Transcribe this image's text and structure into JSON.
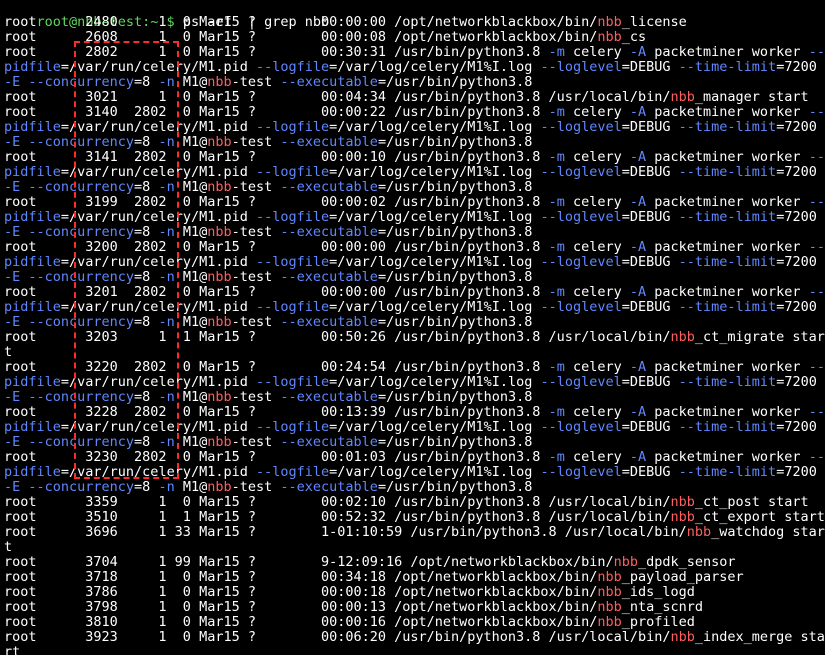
{
  "terminal": {
    "prompt": "root@nbb-test:~ $",
    "command": "ps -ef  | grep nbb",
    "lines": [
      [
        [
          "t",
          "root      2480     1  0 Mar15 ?        00:00:00 /opt/networkblackbox/bin/"
        ],
        [
          "h",
          "nbb"
        ],
        [
          "t",
          "_license"
        ]
      ],
      [
        [
          "t",
          "root      2608     1  0 Mar15 ?        00:00:08 /opt/networkblackbox/bin/"
        ],
        [
          "h",
          "nbb"
        ],
        [
          "t",
          "_cs"
        ]
      ],
      [
        [
          "t",
          "root      2802     1  0 Mar15 ?        00:30:31 /usr/bin/python3.8 "
        ],
        [
          "o",
          "-m"
        ],
        [
          "t",
          " celery "
        ],
        [
          "o",
          "-A"
        ],
        [
          "t",
          " packetminer worker "
        ],
        [
          "o",
          "--"
        ]
      ],
      [
        [
          "o",
          "pidfile"
        ],
        [
          "t",
          "=/var/run/celery/M1.pid "
        ],
        [
          "o",
          "--logfile"
        ],
        [
          "t",
          "=/var/log/celery/M1%I.log "
        ],
        [
          "o",
          "--loglevel"
        ],
        [
          "t",
          "=DEBUG "
        ],
        [
          "o",
          "--time-limit"
        ],
        [
          "t",
          "=7200"
        ]
      ],
      [
        [
          "o",
          "-E --concurrency"
        ],
        [
          "t",
          "=8 "
        ],
        [
          "o",
          "-n"
        ],
        [
          "t",
          " M1@"
        ],
        [
          "h",
          "nbb"
        ],
        [
          "t",
          "-test "
        ],
        [
          "o",
          "--executable"
        ],
        [
          "t",
          "=/usr/bin/python3.8"
        ]
      ],
      [
        [
          "t",
          "root      3021     1  0 Mar15 ?        00:04:34 /usr/bin/python3.8 /usr/local/bin/"
        ],
        [
          "h",
          "nbb"
        ],
        [
          "t",
          "_manager start"
        ]
      ],
      [
        [
          "t",
          "root      3140  2802  0 Mar15 ?        00:00:22 /usr/bin/python3.8 "
        ],
        [
          "o",
          "-m"
        ],
        [
          "t",
          " celery "
        ],
        [
          "o",
          "-A"
        ],
        [
          "t",
          " packetminer worker "
        ],
        [
          "o",
          "--"
        ]
      ],
      [
        [
          "o",
          "pidfile"
        ],
        [
          "t",
          "=/var/run/celery/M1.pid "
        ],
        [
          "o",
          "--logfile"
        ],
        [
          "t",
          "=/var/log/celery/M1%I.log "
        ],
        [
          "o",
          "--loglevel"
        ],
        [
          "t",
          "=DEBUG "
        ],
        [
          "o",
          "--time-limit"
        ],
        [
          "t",
          "=7200"
        ]
      ],
      [
        [
          "o",
          "-E --concurrency"
        ],
        [
          "t",
          "=8 "
        ],
        [
          "o",
          "-n"
        ],
        [
          "t",
          " M1@"
        ],
        [
          "h",
          "nbb"
        ],
        [
          "t",
          "-test "
        ],
        [
          "o",
          "--executable"
        ],
        [
          "t",
          "=/usr/bin/python3.8"
        ]
      ],
      [
        [
          "t",
          "root      3141  2802  0 Mar15 ?        00:00:10 /usr/bin/python3.8 "
        ],
        [
          "o",
          "-m"
        ],
        [
          "t",
          " celery "
        ],
        [
          "o",
          "-A"
        ],
        [
          "t",
          " packetminer worker "
        ],
        [
          "o",
          "--"
        ]
      ],
      [
        [
          "o",
          "pidfile"
        ],
        [
          "t",
          "=/var/run/celery/M1.pid "
        ],
        [
          "o",
          "--logfile"
        ],
        [
          "t",
          "=/var/log/celery/M1%I.log "
        ],
        [
          "o",
          "--loglevel"
        ],
        [
          "t",
          "=DEBUG "
        ],
        [
          "o",
          "--time-limit"
        ],
        [
          "t",
          "=7200"
        ]
      ],
      [
        [
          "o",
          "-E --concurrency"
        ],
        [
          "t",
          "=8 "
        ],
        [
          "o",
          "-n"
        ],
        [
          "t",
          " M1@"
        ],
        [
          "h",
          "nbb"
        ],
        [
          "t",
          "-test "
        ],
        [
          "o",
          "--executable"
        ],
        [
          "t",
          "=/usr/bin/python3.8"
        ]
      ],
      [
        [
          "t",
          "root      3199  2802  0 Mar15 ?        00:00:02 /usr/bin/python3.8 "
        ],
        [
          "o",
          "-m"
        ],
        [
          "t",
          " celery "
        ],
        [
          "o",
          "-A"
        ],
        [
          "t",
          " packetminer worker "
        ],
        [
          "o",
          "--"
        ]
      ],
      [
        [
          "o",
          "pidfile"
        ],
        [
          "t",
          "=/var/run/celery/M1.pid "
        ],
        [
          "o",
          "--logfile"
        ],
        [
          "t",
          "=/var/log/celery/M1%I.log "
        ],
        [
          "o",
          "--loglevel"
        ],
        [
          "t",
          "=DEBUG "
        ],
        [
          "o",
          "--time-limit"
        ],
        [
          "t",
          "=7200"
        ]
      ],
      [
        [
          "o",
          "-E --concurrency"
        ],
        [
          "t",
          "=8 "
        ],
        [
          "o",
          "-n"
        ],
        [
          "t",
          " M1@"
        ],
        [
          "h",
          "nbb"
        ],
        [
          "t",
          "-test "
        ],
        [
          "o",
          "--executable"
        ],
        [
          "t",
          "=/usr/bin/python3.8"
        ]
      ],
      [
        [
          "t",
          "root      3200  2802  0 Mar15 ?        00:00:00 /usr/bin/python3.8 "
        ],
        [
          "o",
          "-m"
        ],
        [
          "t",
          " celery "
        ],
        [
          "o",
          "-A"
        ],
        [
          "t",
          " packetminer worker "
        ],
        [
          "o",
          "--"
        ]
      ],
      [
        [
          "o",
          "pidfile"
        ],
        [
          "t",
          "=/var/run/celery/M1.pid "
        ],
        [
          "o",
          "--logfile"
        ],
        [
          "t",
          "=/var/log/celery/M1%I.log "
        ],
        [
          "o",
          "--loglevel"
        ],
        [
          "t",
          "=DEBUG "
        ],
        [
          "o",
          "--time-limit"
        ],
        [
          "t",
          "=7200"
        ]
      ],
      [
        [
          "o",
          "-E --concurrency"
        ],
        [
          "t",
          "=8 "
        ],
        [
          "o",
          "-n"
        ],
        [
          "t",
          " M1@"
        ],
        [
          "h",
          "nbb"
        ],
        [
          "t",
          "-test "
        ],
        [
          "o",
          "--executable"
        ],
        [
          "t",
          "=/usr/bin/python3.8"
        ]
      ],
      [
        [
          "t",
          "root      3201  2802  0 Mar15 ?        00:00:00 /usr/bin/python3.8 "
        ],
        [
          "o",
          "-m"
        ],
        [
          "t",
          " celery "
        ],
        [
          "o",
          "-A"
        ],
        [
          "t",
          " packetminer worker "
        ],
        [
          "o",
          "--"
        ]
      ],
      [
        [
          "o",
          "pidfile"
        ],
        [
          "t",
          "=/var/run/celery/M1.pid "
        ],
        [
          "o",
          "--logfile"
        ],
        [
          "t",
          "=/var/log/celery/M1%I.log "
        ],
        [
          "o",
          "--loglevel"
        ],
        [
          "t",
          "=DEBUG "
        ],
        [
          "o",
          "--time-limit"
        ],
        [
          "t",
          "=7200"
        ]
      ],
      [
        [
          "o",
          "-E --concurrency"
        ],
        [
          "t",
          "=8 "
        ],
        [
          "o",
          "-n"
        ],
        [
          "t",
          " M1@"
        ],
        [
          "h",
          "nbb"
        ],
        [
          "t",
          "-test "
        ],
        [
          "o",
          "--executable"
        ],
        [
          "t",
          "=/usr/bin/python3.8"
        ]
      ],
      [
        [
          "t",
          "root      3203     1  1 Mar15 ?        00:50:26 /usr/bin/python3.8 /usr/local/bin/"
        ],
        [
          "h",
          "nbb"
        ],
        [
          "t",
          "_ct_migrate star"
        ]
      ],
      [
        [
          "t",
          "t"
        ]
      ],
      [
        [
          "t",
          "root      3220  2802  0 Mar15 ?        00:24:54 /usr/bin/python3.8 "
        ],
        [
          "o",
          "-m"
        ],
        [
          "t",
          " celery "
        ],
        [
          "o",
          "-A"
        ],
        [
          "t",
          " packetminer worker "
        ],
        [
          "o",
          "--"
        ]
      ],
      [
        [
          "o",
          "pidfile"
        ],
        [
          "t",
          "=/var/run/celery/M1.pid "
        ],
        [
          "o",
          "--logfile"
        ],
        [
          "t",
          "=/var/log/celery/M1%I.log "
        ],
        [
          "o",
          "--loglevel"
        ],
        [
          "t",
          "=DEBUG "
        ],
        [
          "o",
          "--time-limit"
        ],
        [
          "t",
          "=7200"
        ]
      ],
      [
        [
          "o",
          "-E --concurrency"
        ],
        [
          "t",
          "=8 "
        ],
        [
          "o",
          "-n"
        ],
        [
          "t",
          " M1@"
        ],
        [
          "h",
          "nbb"
        ],
        [
          "t",
          "-test "
        ],
        [
          "o",
          "--executable"
        ],
        [
          "t",
          "=/usr/bin/python3.8"
        ]
      ],
      [
        [
          "t",
          "root      3228  2802  0 Mar15 ?        00:13:39 /usr/bin/python3.8 "
        ],
        [
          "o",
          "-m"
        ],
        [
          "t",
          " celery "
        ],
        [
          "o",
          "-A"
        ],
        [
          "t",
          " packetminer worker "
        ],
        [
          "o",
          "--"
        ]
      ],
      [
        [
          "o",
          "pidfile"
        ],
        [
          "t",
          "=/var/run/celery/M1.pid "
        ],
        [
          "o",
          "--logfile"
        ],
        [
          "t",
          "=/var/log/celery/M1%I.log "
        ],
        [
          "o",
          "--loglevel"
        ],
        [
          "t",
          "=DEBUG "
        ],
        [
          "o",
          "--time-limit"
        ],
        [
          "t",
          "=7200"
        ]
      ],
      [
        [
          "o",
          "-E --concurrency"
        ],
        [
          "t",
          "=8 "
        ],
        [
          "o",
          "-n"
        ],
        [
          "t",
          " M1@"
        ],
        [
          "h",
          "nbb"
        ],
        [
          "t",
          "-test "
        ],
        [
          "o",
          "--executable"
        ],
        [
          "t",
          "=/usr/bin/python3.8"
        ]
      ],
      [
        [
          "t",
          "root      3230  2802  0 Mar15 ?        00:01:03 /usr/bin/python3.8 "
        ],
        [
          "o",
          "-m"
        ],
        [
          "t",
          " celery "
        ],
        [
          "o",
          "-A"
        ],
        [
          "t",
          " packetminer worker "
        ],
        [
          "o",
          "--"
        ]
      ],
      [
        [
          "o",
          "pidfile"
        ],
        [
          "t",
          "=/var/run/celery/M1.pid "
        ],
        [
          "o",
          "--logfile"
        ],
        [
          "t",
          "=/var/log/celery/M1%I.log "
        ],
        [
          "o",
          "--loglevel"
        ],
        [
          "t",
          "=DEBUG "
        ],
        [
          "o",
          "--time-limit"
        ],
        [
          "t",
          "=7200"
        ]
      ],
      [
        [
          "o",
          "-E --concurrency"
        ],
        [
          "t",
          "=8 "
        ],
        [
          "o",
          "-n"
        ],
        [
          "t",
          " M1@"
        ],
        [
          "h",
          "nbb"
        ],
        [
          "t",
          "-test "
        ],
        [
          "o",
          "--executable"
        ],
        [
          "t",
          "=/usr/bin/python3.8"
        ]
      ],
      [
        [
          "t",
          "root      3359     1  0 Mar15 ?        00:02:10 /usr/bin/python3.8 /usr/local/bin/"
        ],
        [
          "h",
          "nbb"
        ],
        [
          "t",
          "_ct_post start"
        ]
      ],
      [
        [
          "t",
          "root      3510     1  1 Mar15 ?        00:52:32 /usr/bin/python3.8 /usr/local/bin/"
        ],
        [
          "h",
          "nbb"
        ],
        [
          "t",
          "_ct_export start"
        ]
      ],
      [
        [
          "t",
          "root      3696     1 33 Mar15 ?        1-01:10:59 /usr/bin/python3.8 /usr/local/bin/"
        ],
        [
          "h",
          "nbb"
        ],
        [
          "t",
          "_watchdog star"
        ]
      ],
      [
        [
          "t",
          "t"
        ]
      ],
      [
        [
          "t",
          "root      3704     1 99 Mar15 ?        9-12:09:16 /opt/networkblackbox/bin/"
        ],
        [
          "h",
          "nbb"
        ],
        [
          "t",
          "_dpdk_sensor"
        ]
      ],
      [
        [
          "t",
          "root      3718     1  0 Mar15 ?        00:34:18 /opt/networkblackbox/bin/"
        ],
        [
          "h",
          "nbb"
        ],
        [
          "t",
          "_payload_parser"
        ]
      ],
      [
        [
          "t",
          "root      3786     1  0 Mar15 ?        00:00:18 /opt/networkblackbox/bin/"
        ],
        [
          "h",
          "nbb"
        ],
        [
          "t",
          "_ids_logd"
        ]
      ],
      [
        [
          "t",
          "root      3798     1  0 Mar15 ?        00:00:13 /opt/networkblackbox/bin/"
        ],
        [
          "h",
          "nbb"
        ],
        [
          "t",
          "_nta_scnrd"
        ]
      ],
      [
        [
          "t",
          "root      3810     1  0 Mar15 ?        00:00:16 /opt/networkblackbox/bin/"
        ],
        [
          "h",
          "nbb"
        ],
        [
          "t",
          "_profiled"
        ]
      ],
      [
        [
          "t",
          "root      3923     1  0 Mar15 ?        00:06:20 /usr/bin/python3.8 /usr/local/bin/"
        ],
        [
          "h",
          "nbb"
        ],
        [
          "t",
          "_index_merge sta"
        ]
      ],
      [
        [
          "t",
          "rt"
        ]
      ]
    ]
  },
  "colors": {
    "background": "#000000",
    "prompt": "#5fd75f",
    "text": "#ffffff",
    "option": "#5f87ff",
    "match_highlight": "#ff5f5f",
    "annotation_box": "#ff2a2a"
  }
}
